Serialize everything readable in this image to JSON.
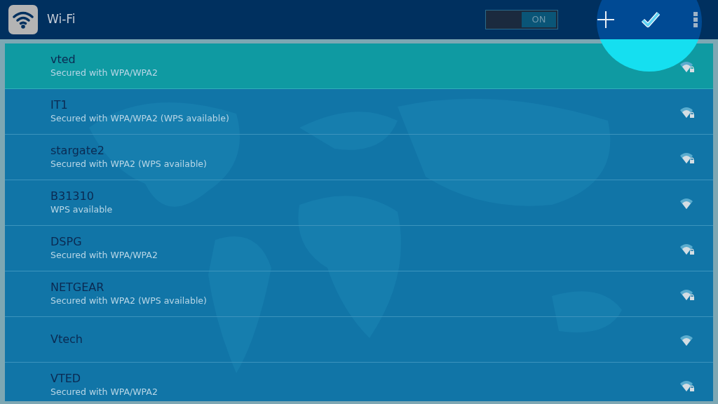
{
  "action_bar": {
    "title": "Wi-Fi",
    "wifi_switch": {
      "label": "ON",
      "on": true
    }
  },
  "networks": [
    {
      "name": "vted",
      "status": "Secured with WPA/WPA2",
      "secured": true,
      "selected": true
    },
    {
      "name": "IT1",
      "status": "Secured with WPA/WPA2 (WPS available)",
      "secured": true,
      "selected": false
    },
    {
      "name": "stargate2",
      "status": "Secured with WPA2 (WPS available)",
      "secured": true,
      "selected": false
    },
    {
      "name": "B31310",
      "status": "WPS available",
      "secured": false,
      "selected": false
    },
    {
      "name": "DSPG",
      "status": "Secured with WPA/WPA2",
      "secured": true,
      "selected": false
    },
    {
      "name": "NETGEAR",
      "status": "Secured with WPA2 (WPS available)",
      "secured": true,
      "selected": false
    },
    {
      "name": "Vtech",
      "secured": false,
      "selected": false
    },
    {
      "name": "VTED",
      "status": "Secured with WPA/WPA2",
      "secured": true,
      "selected": false
    }
  ]
}
